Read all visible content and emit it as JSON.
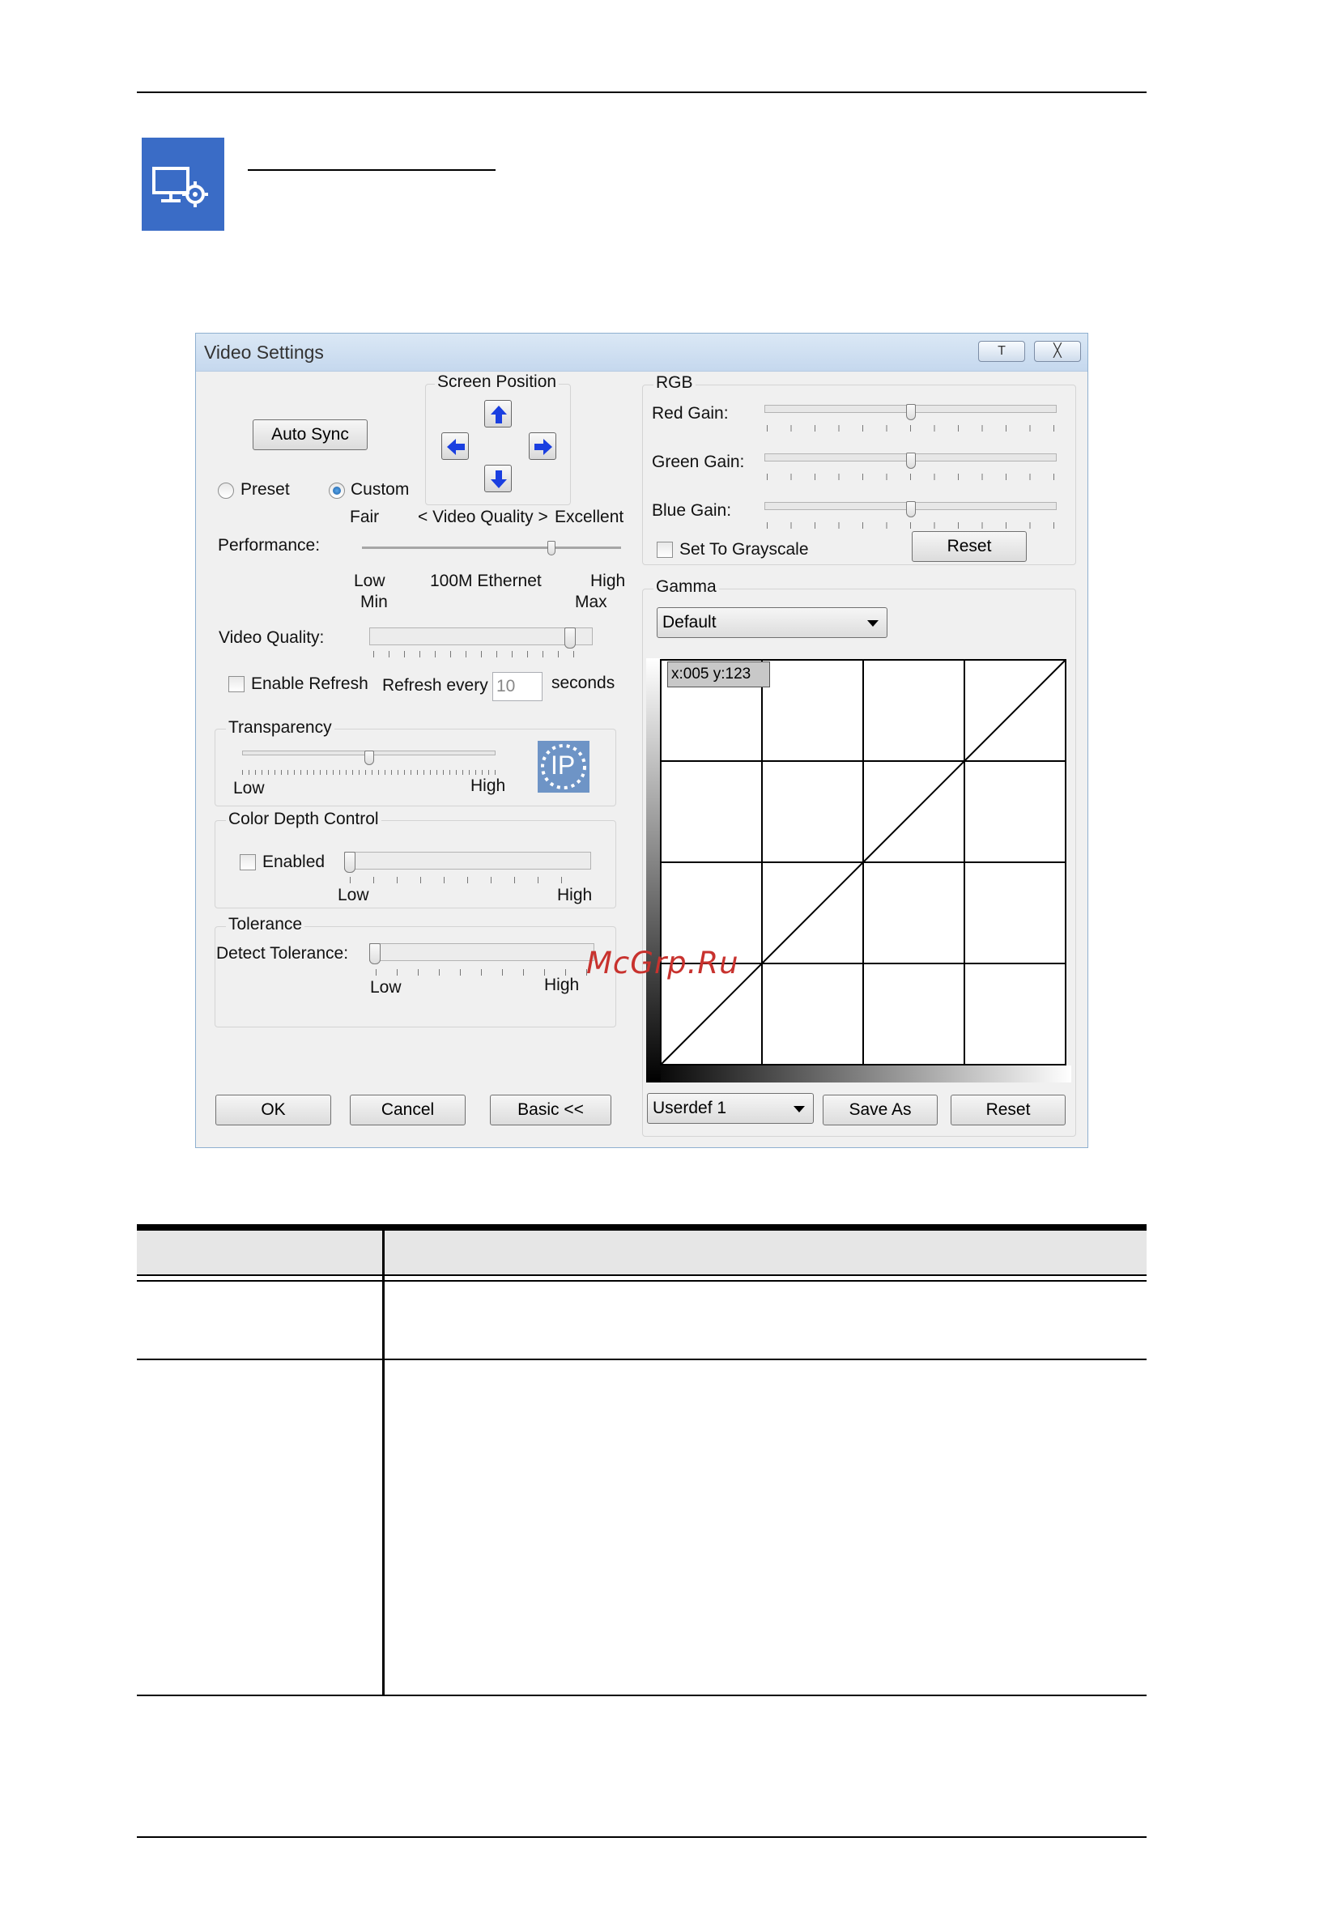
{
  "dialog": {
    "title": "Video Settings",
    "titlebar_buttons": {
      "pin": "T",
      "close": "╳"
    },
    "screen_position": {
      "title": "Screen Position"
    },
    "auto_sync": "Auto Sync",
    "preset_label": "Preset",
    "custom_label": "Custom",
    "custom_selected": true,
    "performance": {
      "fair": "Fair",
      "video_quality_arrows": "< Video Quality >",
      "excellent": "Excellent",
      "label": "Performance:",
      "low": "Low",
      "ethernet": "100M Ethernet",
      "high": "High",
      "min": "Min",
      "max": "Max",
      "level": 0.74
    },
    "video_quality": {
      "label": "Video Quality:",
      "level": 0.92
    },
    "refresh": {
      "enable_label": "Enable Refresh",
      "every_label": "Refresh every",
      "value": "10",
      "seconds_label": "seconds",
      "enabled": false
    },
    "transparency": {
      "title": "Transparency",
      "low": "Low",
      "high": "High",
      "level": 0.5,
      "badge": "IP"
    },
    "color_depth": {
      "title": "Color Depth Control",
      "enabled_label": "Enabled",
      "low": "Low",
      "high": "High",
      "enabled": false,
      "level": 0.0
    },
    "tolerance": {
      "title": "Tolerance",
      "label": "Detect Tolerance:",
      "low": "Low",
      "high": "High",
      "level": 0.0
    },
    "ok": "OK",
    "cancel": "Cancel",
    "basic": "Basic <<",
    "rgb": {
      "title": "RGB",
      "red_label": "Red Gain:",
      "green_label": "Green Gain:",
      "blue_label": "Blue Gain:",
      "red_level": 0.5,
      "green_level": 0.5,
      "blue_level": 0.5,
      "grayscale_label": "Set To Grayscale",
      "grayscale": false,
      "reset": "Reset"
    },
    "gamma": {
      "title": "Gamma",
      "preset": "Default",
      "tooltip": "x:005 y:123",
      "profile": "Userdef 1",
      "save_as": "Save As",
      "reset": "Reset"
    }
  },
  "watermark": "McGrp.Ru",
  "colors": {
    "feature_icon_bg": "#3a6cc6",
    "arrow_blue": "#1a3fe0",
    "watermark": "#c8322e"
  }
}
